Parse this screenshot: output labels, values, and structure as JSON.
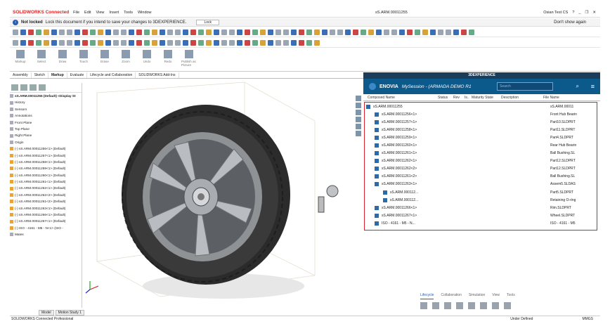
{
  "app": {
    "logo": "SOLIDWORKS Connected",
    "doc_title": "sS.ARM.00011255",
    "user": "Osian Test CS"
  },
  "menu": [
    "File",
    "Edit",
    "View",
    "Insert",
    "Tools",
    "Window"
  ],
  "info": {
    "status": "Not locked",
    "message": "Lock this document if you intend to save your changes to 3DEXPERIENCE.",
    "lock_label": "Lock",
    "dont_show": "Don't show again"
  },
  "ribbon": {
    "items": [
      "Markup",
      "Select",
      "Draw",
      "Touch",
      "Erase",
      "Zoom",
      "Undo",
      "Redo",
      "Publish as Picture"
    ],
    "publish": "Publish as Picture"
  },
  "tabs": [
    "Assembly",
    "Sketch",
    "Markup",
    "Evaluate",
    "Lifecycle and Collaboration",
    "SOLIDWORKS Add-Ins"
  ],
  "tree": {
    "root": "sS.ARM.00011255 (Default) <Display St",
    "items": [
      "History",
      "Sensors",
      "Annotations",
      "Front Plane",
      "Top Plane",
      "Right Plane",
      "Origin",
      "(-) sS.ARM.00011256<1> (Default)",
      "(-) sS.ARM.00011257<1> (Default)",
      "(-) sS.ARM.00011258<1> (Default)",
      "(-) sS.ARM.00011259<1> (Default)",
      "(-) sS.ARM.00011260<1> (Default)",
      "(-) sS.ARM.00011261<1> (Default)",
      "(-) sS.ARM.00011262<1> (Default)",
      "(-) sS.ARM.00011262<2> (Default)",
      "(-) sS.ARM.00011261<2> (Default)",
      "(-) sS.ARM.00011263<1> (Default)",
      "(-) sS.ARM.00011266<1> (Default)",
      "(-) sS.ARM.00011267<1> (Default)",
      "(-) ISO - 4161 - M5 - N<1> (ISO -",
      "Mates"
    ]
  },
  "bottom_tabs": [
    "Model",
    "Motion Study 1"
  ],
  "status": {
    "left": "SOLIDWORKS Connected Professional",
    "mid": "Under Defined",
    "right": "MMGS"
  },
  "experience": {
    "header": "3DEXPERIENCE",
    "brand": "ENOVIA",
    "session": "MySession - (ARMADA DEMO R1",
    "search_placeholder": "Search",
    "columns": [
      "Composed Name",
      "Status",
      "Rev",
      "Is..",
      "Maturity State",
      "Description",
      "File Name"
    ],
    "rows": [
      {
        "name": "sS.ARM.00011255",
        "file": "sS.ARM.00011",
        "indent": 0
      },
      {
        "name": "sS.ARM.00011256<1>",
        "file": "Front Hub Bearin",
        "indent": 1
      },
      {
        "name": "sS.ARM.00011257<1>",
        "file": "Part10.SLDPRT",
        "indent": 1
      },
      {
        "name": "sS.ARM.00011258<1>",
        "file": "Part11.SLDPRT",
        "indent": 1
      },
      {
        "name": "sS.ARM.00011259<1>",
        "file": "Part4.SLDPRT",
        "indent": 1
      },
      {
        "name": "sS.ARM.00011260<1>",
        "file": "Rear Hub Bearin",
        "indent": 1
      },
      {
        "name": "sS.ARM.00011261<1>",
        "file": "Ball Bushing.SL",
        "indent": 1
      },
      {
        "name": "sS.ARM.00011262<1>",
        "file": "Part12.SLDPRT",
        "indent": 1
      },
      {
        "name": "sS.ARM.00011262<2>",
        "file": "Part12.SLDPRT",
        "indent": 1
      },
      {
        "name": "sS.ARM.00011261<2>",
        "file": "Ball Bushing.SL",
        "indent": 1
      },
      {
        "name": "sS.ARM.00011263<1>",
        "file": "Assem5.SLDAS",
        "indent": 1
      },
      {
        "name": "sS.ARM.000112...",
        "file": "Part5.SLDPRT",
        "indent": 2
      },
      {
        "name": "sS.ARM.000112...",
        "file": "Retaining O-ring",
        "indent": 2
      },
      {
        "name": "sS.ARM.00011266<1>",
        "file": "Rim.SLDPRT",
        "indent": 1
      },
      {
        "name": "sS.ARM.00011267<1>",
        "file": "Wheel.SLDPRT",
        "indent": 1
      },
      {
        "name": "ISO - 4161 - M5 - N...",
        "file": "ISO - 4161 - M5",
        "indent": 1
      }
    ],
    "bottom_tabs": [
      "Lifecycle",
      "Collaboration",
      "Simulation",
      "View",
      "Tools"
    ]
  }
}
